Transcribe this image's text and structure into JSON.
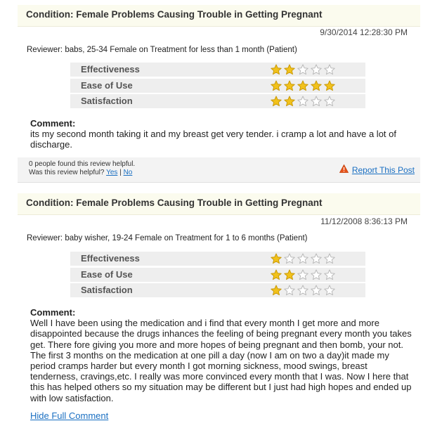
{
  "reviews": [
    {
      "condition": "Condition: Female Problems Causing Trouble in Getting Pregnant",
      "date": "9/30/2014 12:28:30 PM",
      "reviewer": "Reviewer: babs, 25-34 Female on Treatment for less than 1 month (Patient)",
      "ratings": [
        {
          "label": "Effectiveness",
          "stars": 2,
          "max": 5
        },
        {
          "label": "Ease of Use",
          "stars": 5,
          "max": 5
        },
        {
          "label": "Satisfaction",
          "stars": 2,
          "max": 5
        }
      ],
      "comment_label": "Comment:",
      "comment": "its my second month taking it and my breast get very tender. i cramp a lot and have a lot of discharge.",
      "helpful_count": "0 people found this review helpful.",
      "helpful_question": "Was this review helpful?",
      "yes_label": "Yes",
      "separator": "|",
      "no_label": "No",
      "report_label": "Report This Post"
    },
    {
      "condition": "Condition: Female Problems Causing Trouble in Getting Pregnant",
      "date": "11/12/2008 8:36:13 PM",
      "reviewer": "Reviewer: baby wisher, 19-24 Female on Treatment for 1 to 6 months (Patient)",
      "ratings": [
        {
          "label": "Effectiveness",
          "stars": 1,
          "max": 5
        },
        {
          "label": "Ease of Use",
          "stars": 2,
          "max": 5
        },
        {
          "label": "Satisfaction",
          "stars": 1,
          "max": 5
        }
      ],
      "comment_label": "Comment:",
      "comment": "Well I have been using the medication and i find that every month I get more and more disappointed because the drugs inhances the feeling of being pregnant every month you takes get. There fore giving you more and more hopes of being pregnant and then bomb, your not. The first 3 months on the medication at one pill a day (now I am on two a day)it made my period cramps harder but every month I got morning sickness, mood swings, breast tenderness, cravings,etc. I really was more convinced every month that I was. Now I here that this has helped others so my situation may be different but I just had high hopes and ended up with low satisfaction.",
      "hide_label": "Hide Full Comment"
    }
  ],
  "colors": {
    "star_filled": "#f2c21b",
    "star_outline": "#b9b9b9",
    "link": "#1a6fc2",
    "condition_bg": "#fbfbee",
    "rating_bg": "#eeeeee",
    "warning": "#e8541c"
  }
}
